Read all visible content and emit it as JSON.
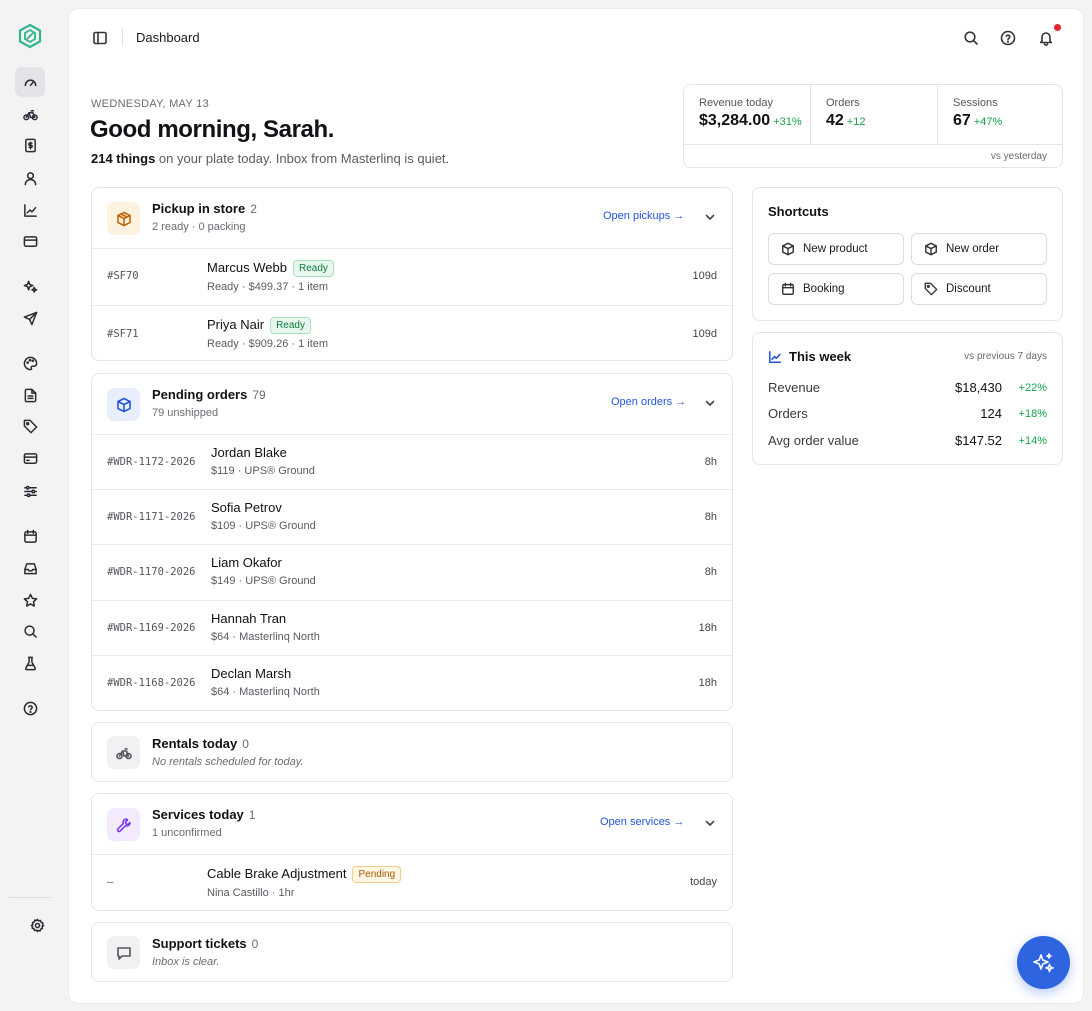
{
  "topbar": {
    "breadcrumb": "Dashboard"
  },
  "rail": {
    "icons": [
      "dashboard-icon",
      "bicycle-icon",
      "receipt-icon",
      "user-icon",
      "chart-icon",
      "card-icon",
      "sparkles-icon",
      "send-icon",
      "palette-icon",
      "document-icon",
      "tag-icon",
      "credit-card-icon",
      "sliders-icon",
      "calendar-icon",
      "inbox-icon",
      "star-icon",
      "search-icon",
      "flask-icon",
      "help-icon",
      "settings-icon"
    ]
  },
  "hero": {
    "date": "WEDNESDAY, MAY 13",
    "greeting": "Good morning, Sarah.",
    "count": "214 things",
    "subtitle_rest": " on your plate today. Inbox from Masterlinq is quiet."
  },
  "kpis": {
    "items": [
      {
        "label": "Revenue today",
        "value": "$3,284.00",
        "delta": "+31%"
      },
      {
        "label": "Orders",
        "value": "42",
        "delta": "+12"
      },
      {
        "label": "Sessions",
        "value": "67",
        "delta": "+47%"
      }
    ],
    "footnote": "vs yesterday"
  },
  "pickups": {
    "title": "Pickup in store",
    "count": "2",
    "subtitle": "2 ready · 0 packing",
    "link": "Open pickups →",
    "rows": [
      {
        "id": "#SF70",
        "name": "Marcus Webb",
        "badge": "Ready",
        "meta": "Ready · $499.37 · 1 item",
        "time": "109d"
      },
      {
        "id": "#SF71",
        "name": "Priya Nair",
        "badge": "Ready",
        "meta": "Ready · $909.26 · 1 item",
        "time": "109d"
      }
    ]
  },
  "orders": {
    "title": "Pending orders",
    "count": "79",
    "subtitle": "79 unshipped",
    "link": "Open orders →",
    "rows": [
      {
        "id": "#WDR-1172-2026",
        "name": "Jordan Blake",
        "meta": "$119 · UPS® Ground",
        "time": "8h"
      },
      {
        "id": "#WDR-1171-2026",
        "name": "Sofia Petrov",
        "meta": "$109 · UPS® Ground",
        "time": "8h"
      },
      {
        "id": "#WDR-1170-2026",
        "name": "Liam Okafor",
        "meta": "$149 · UPS® Ground",
        "time": "8h"
      },
      {
        "id": "#WDR-1169-2026",
        "name": "Hannah Tran",
        "meta": "$64 · Masterlinq North",
        "time": "18h"
      },
      {
        "id": "#WDR-1168-2026",
        "name": "Declan Marsh",
        "meta": "$64 · Masterlinq North",
        "time": "18h"
      }
    ]
  },
  "rentals": {
    "title": "Rentals today",
    "count": "0",
    "subtitle": "No rentals scheduled for today."
  },
  "services": {
    "title": "Services today",
    "count": "1",
    "subtitle": "1 unconfirmed",
    "link": "Open services →",
    "rows": [
      {
        "id": "—",
        "name": "Cable Brake Adjustment",
        "badge": "Pending",
        "meta": "Nina Castillo · 1hr",
        "time": "today"
      }
    ]
  },
  "support": {
    "title": "Support tickets",
    "count": "0",
    "subtitle": "Inbox is clear."
  },
  "shortcuts": {
    "title": "Shortcuts",
    "buttons": [
      "New product",
      "New order",
      "Booking",
      "Discount"
    ]
  },
  "week": {
    "title": "This week",
    "note": "vs previous 7 days",
    "rows": [
      {
        "label": "Revenue",
        "value": "$18,430",
        "delta": "+22%"
      },
      {
        "label": "Orders",
        "value": "124",
        "delta": "+18%"
      },
      {
        "label": "Avg order value",
        "value": "$147.52",
        "delta": "+14%"
      }
    ]
  },
  "colors": {
    "accent": "#2356d6",
    "positive": "#15a34a",
    "fab": "#2f64e0",
    "brand": "#2fb58a"
  }
}
